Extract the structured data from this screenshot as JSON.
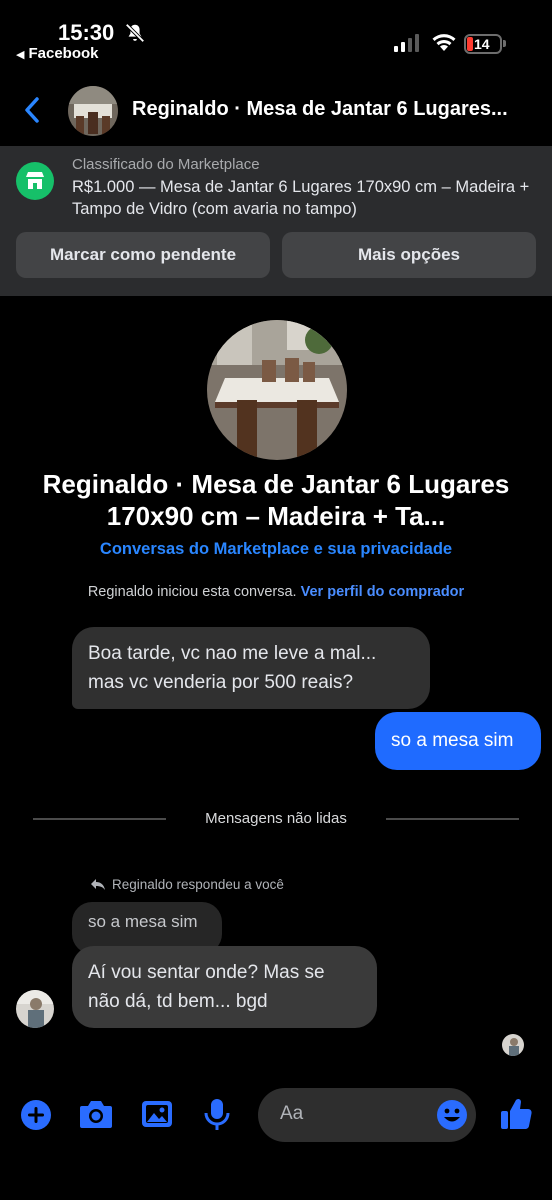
{
  "status_bar": {
    "time": "15:30",
    "back_app": "Facebook",
    "battery": "14"
  },
  "header": {
    "title": "Reginaldo · Mesa de Jantar 6 Lugares..."
  },
  "listing": {
    "label": "Classificado do Marketplace",
    "description": "R$1.000 — Mesa de Jantar 6 Lugares 170x90 cm – Madeira + Tampo de Vidro (com avaria no tampo)",
    "mark_pending": "Marcar como pendente",
    "more_options": "Mais opções",
    "icon": "marketplace-store-icon"
  },
  "profile": {
    "title": "Reginaldo · Mesa de Jantar 6 Lugares 170x90 cm – Madeira + Ta...",
    "privacy_link": "Conversas do Marketplace e sua privacidade",
    "started_text": "Reginaldo iniciou esta conversa.",
    "view_profile": "Ver perfil do comprador"
  },
  "messages": [
    {
      "from": "Reginaldo",
      "text": "Boa tarde,  vc nao me leve a mal... mas vc venderia por 500 reais?"
    },
    {
      "from": "me",
      "text": "so a mesa sim"
    },
    {
      "from": "Reginaldo",
      "reply_note": "Reginaldo respondeu a você",
      "quoted": "so a mesa sim",
      "text": "Aí vou sentar onde? Mas se não dá, td bem... bgd"
    }
  ],
  "unread_divider": "Mensagens não lidas",
  "composer": {
    "placeholder": "Aa"
  },
  "colors": {
    "accent": "#1f6bff",
    "marketplace_green": "#16c069",
    "banner_bg": "#2b2c2e"
  }
}
